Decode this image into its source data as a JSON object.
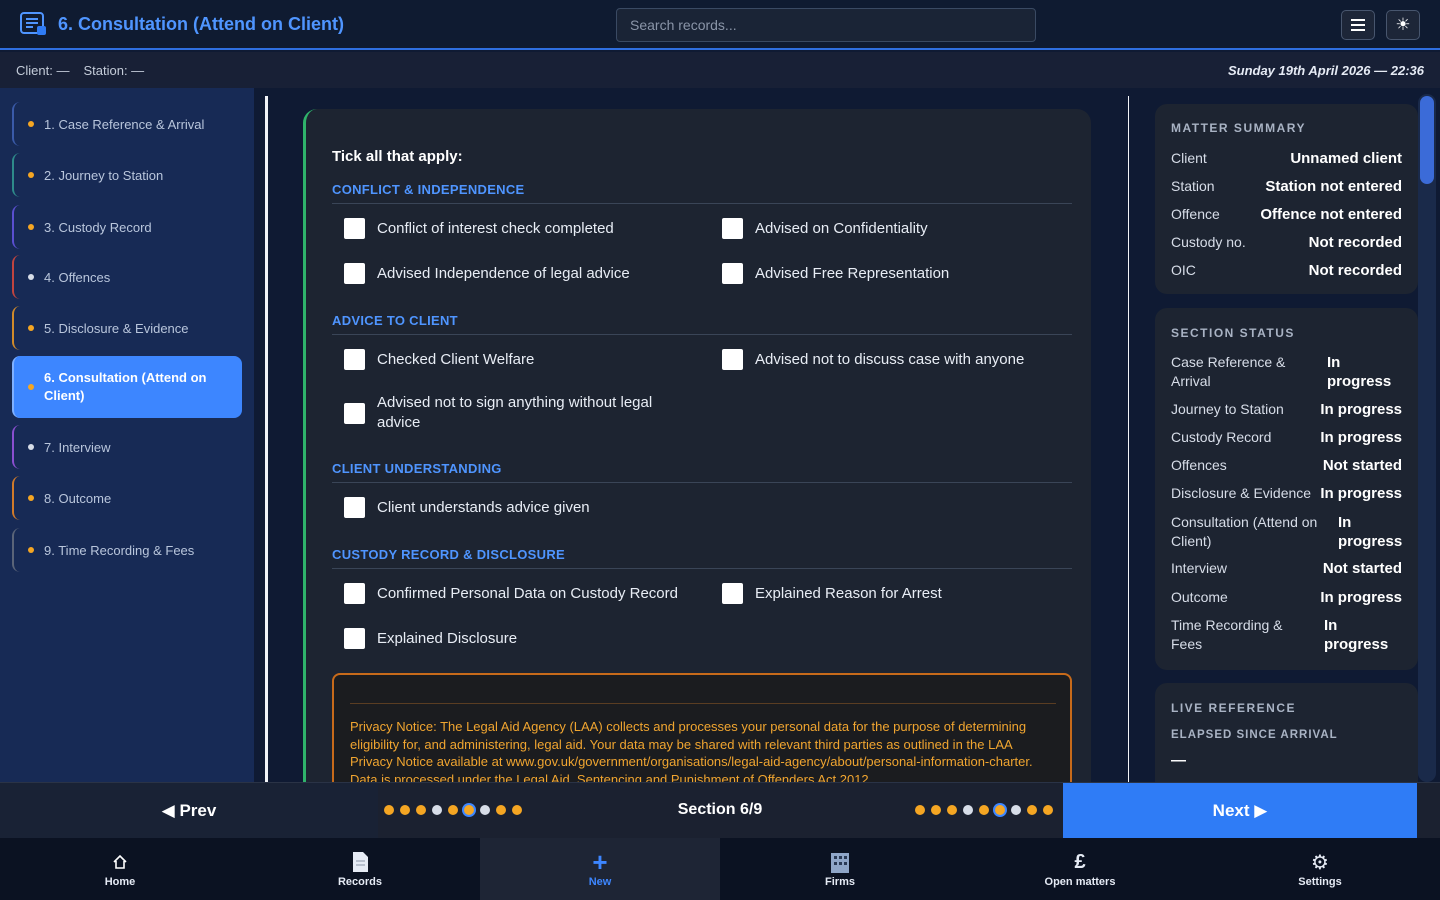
{
  "header": {
    "title": "6. Consultation (Attend on Client)",
    "search_placeholder": "Search records...",
    "menu_icon": "hamburger-icon",
    "theme_icon": "sun-icon"
  },
  "infobar": {
    "client": "Client: —",
    "station": "Station: —",
    "date": "Sunday 19th April 2026 — 22:36"
  },
  "sidebar": {
    "items": [
      {
        "label": "1. Case Reference & Arrival",
        "dot": "#f5a623",
        "border": "#3a5aa8"
      },
      {
        "label": "2. Journey to Station",
        "dot": "#f5a623",
        "border": "#2e8a8a"
      },
      {
        "label": "3. Custody Record",
        "dot": "#f5a623",
        "border": "#5a4fd0"
      },
      {
        "label": "4. Offences",
        "dot": "#d7dde8",
        "border": "#c0443f"
      },
      {
        "label": "5. Disclosure & Evidence",
        "dot": "#f5a623",
        "border": "#d08a2a"
      },
      {
        "label": "6. Consultation (Attend on Client)",
        "dot": "#f5a623",
        "border": "#7fb0ff"
      },
      {
        "label": "7. Interview",
        "dot": "#d7dde8",
        "border": "#8a4fd0"
      },
      {
        "label": "8. Outcome",
        "dot": "#f5a623",
        "border": "#d07a2a"
      },
      {
        "label": "9. Time Recording & Fees",
        "dot": "#f5a623",
        "border": "#5a6478"
      }
    ]
  },
  "main": {
    "tick_heading": "Tick all that apply:",
    "sections": {
      "conflict": "CONFLICT & INDEPENDENCE",
      "advice": "ADVICE TO CLIENT",
      "understanding": "CLIENT UNDERSTANDING",
      "custody": "CUSTODY RECORD & DISCLOSURE"
    },
    "checks": {
      "conflict_check": "Conflict of interest check completed",
      "confidentiality": "Advised on Confidentiality",
      "independence": "Advised Independence of legal advice",
      "free_rep": "Advised Free Representation",
      "welfare": "Checked Client Welfare",
      "not_discuss": "Advised not to discuss case with anyone",
      "not_sign": "Advised not to sign anything without legal advice",
      "understands": "Client understands advice given",
      "personal_data": "Confirmed Personal Data on Custody Record",
      "reason_arrest": "Explained Reason for Arrest",
      "disclosure": "Explained Disclosure"
    },
    "privacy_notice": "Privacy Notice: The Legal Aid Agency (LAA) collects and processes your personal data for the purpose of determining eligibility for, and administering, legal aid. Your data may be shared with relevant third parties as outlined in the LAA Privacy Notice available at www.gov.uk/government/organisations/legal-aid-agency/about/personal-information-charter. Data is processed under the Legal Aid, Sentencing and Punishment of Offenders Act 2012."
  },
  "matter_summary": {
    "title": "MATTER SUMMARY",
    "rows": [
      {
        "label": "Client",
        "value": "Unnamed client"
      },
      {
        "label": "Station",
        "value": "Station not entered"
      },
      {
        "label": "Offence",
        "value": "Offence not entered"
      },
      {
        "label": "Custody no.",
        "value": "Not recorded"
      },
      {
        "label": "OIC",
        "value": "Not recorded"
      }
    ]
  },
  "section_status": {
    "title": "SECTION STATUS",
    "rows": [
      {
        "label": "Case Reference & Arrival",
        "value": "In progress"
      },
      {
        "label": "Journey to Station",
        "value": "In progress"
      },
      {
        "label": "Custody Record",
        "value": "In progress"
      },
      {
        "label": "Offences",
        "value": "Not started"
      },
      {
        "label": "Disclosure & Evidence",
        "value": "In progress"
      },
      {
        "label": "Consultation (Attend on Client)",
        "value": "In progress"
      },
      {
        "label": "Interview",
        "value": "Not started"
      },
      {
        "label": "Outcome",
        "value": "In progress"
      },
      {
        "label": "Time Recording & Fees",
        "value": "In progress"
      }
    ]
  },
  "live_reference": {
    "title": "LIVE REFERENCE",
    "elapsed_label": "ELAPSED SINCE ARRIVAL",
    "elapsed_value": "—"
  },
  "pager": {
    "prev": "◀ Prev",
    "next": "Next ▶",
    "section": "Section 6/9",
    "current_section": 6,
    "total_sections": 9,
    "dot_colors": [
      "#f5a623",
      "#f5a623",
      "#f5a623",
      "#d7dde8",
      "#f5a623",
      "#f5a623",
      "#d7dde8",
      "#f5a623",
      "#f5a623"
    ]
  },
  "bottom_nav": {
    "items": [
      {
        "label": "Home",
        "icon": "home-icon"
      },
      {
        "label": "Records",
        "icon": "document-icon"
      },
      {
        "label": "New",
        "icon": "plus-icon"
      },
      {
        "label": "Firms",
        "icon": "building-icon"
      },
      {
        "label": "Open matters",
        "icon": "pound-icon"
      },
      {
        "label": "Settings",
        "icon": "gear-icon"
      }
    ]
  }
}
